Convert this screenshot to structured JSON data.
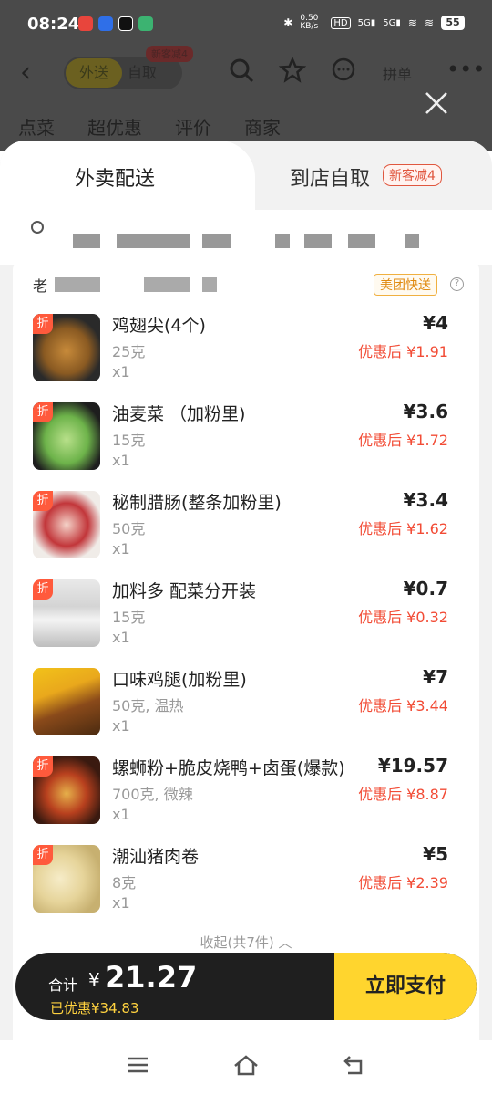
{
  "status_bar": {
    "time": "08:24",
    "network_speed": "0.50 KB/s",
    "hd_label": "HD",
    "sim1": "5G",
    "sim2": "5G",
    "battery": "55"
  },
  "background_app": {
    "toggle_delivery": "外送",
    "toggle_pickup": "自取",
    "promo_badge": "新客减4",
    "pindan": "拼单",
    "tabs": [
      "点菜",
      "超优惠",
      "评价",
      "商家"
    ]
  },
  "sheet": {
    "tab_delivery": "外卖配送",
    "tab_pickup": "到店自取",
    "new_customer_badge": "新客减4",
    "store_name_prefix": "老",
    "meituan_badge": "美团快送",
    "items": [
      {
        "name": "鸡翅尖(4个)",
        "spec": "25克",
        "qty": "x1",
        "price": "¥4",
        "discount": "优惠后 ¥1.91"
      },
      {
        "name": "油麦菜  （加粉里)",
        "spec": "15克",
        "qty": "x1",
        "price": "¥3.6",
        "discount": "优惠后 ¥1.72"
      },
      {
        "name": "秘制腊肠(整条加粉里)",
        "spec": "50克",
        "qty": "x1",
        "price": "¥3.4",
        "discount": "优惠后 ¥1.62"
      },
      {
        "name": "加料多 配菜分开装",
        "spec": "15克",
        "qty": "x1",
        "price": "¥0.7",
        "discount": "优惠后 ¥0.32"
      },
      {
        "name": "口味鸡腿(加粉里)",
        "spec": "50克, 温热",
        "qty": "x1",
        "price": "¥7",
        "discount": "优惠后 ¥3.44"
      },
      {
        "name": "螺蛳粉+脆皮烧鸭+卤蛋(爆款)",
        "spec": "700克, 微辣",
        "qty": "x1",
        "price": "¥19.57",
        "discount": "优惠后 ¥8.87"
      },
      {
        "name": "潮汕猪肉卷",
        "spec": "8克",
        "qty": "x1",
        "price": "¥5",
        "discount": "优惠后 ¥2.39"
      }
    ],
    "discount_tag": "折",
    "collapse_label": "收起(共7件) ︿"
  },
  "pay_bar": {
    "total_label": "合计",
    "currency": "¥",
    "total": "21.27",
    "saved": "已优惠¥34.83",
    "pay_button": "立即支付"
  },
  "colors": {
    "accent_yellow": "#ffd52e",
    "discount_red": "#f24c36",
    "dark_bar": "#1f1f1f"
  }
}
